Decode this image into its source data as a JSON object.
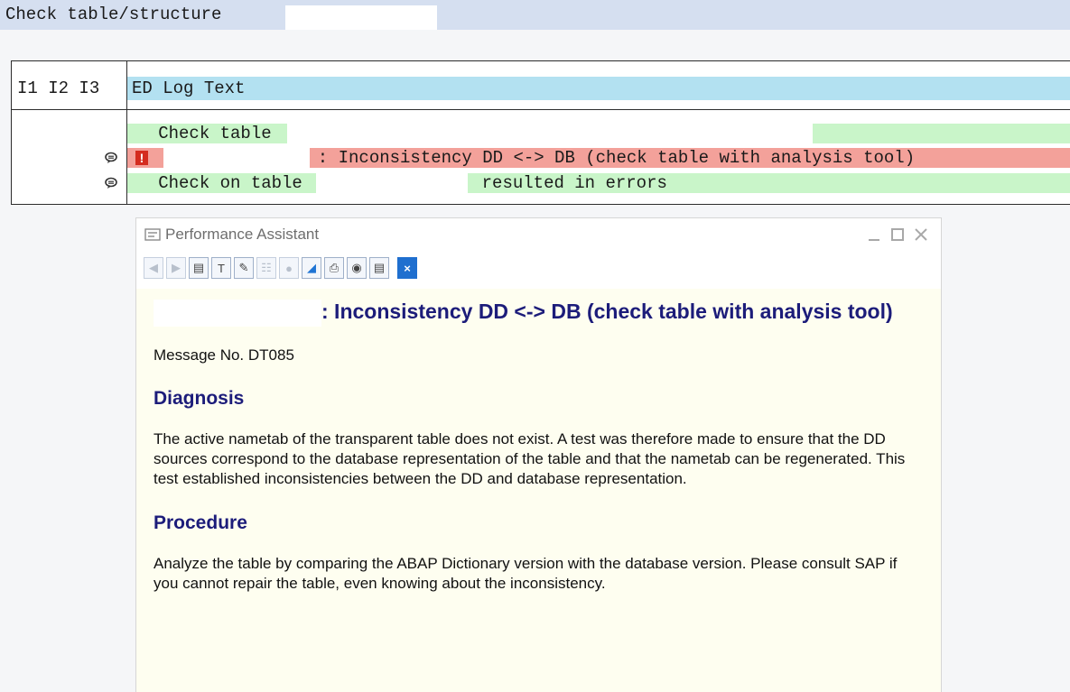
{
  "titlebar": {
    "title": "Check table/structure"
  },
  "log": {
    "header_left": "I1 I2 I3",
    "header_right": "ED Log Text",
    "rows": [
      {
        "text": "   Check table",
        "color": "green",
        "icon": ""
      },
      {
        "text": "  : Inconsistency DD <-> DB (check table with analysis tool)",
        "color": "red",
        "icon": "message-icon"
      },
      {
        "text": "   Check on table",
        "suffix": "resulted in errors",
        "color": "green",
        "icon": "message-icon"
      }
    ]
  },
  "dialog": {
    "title": "Performance Assistant",
    "message_title": ": Inconsistency DD <-> DB (check table with analysis tool)",
    "message_no": "Message No. DT085",
    "diagnosis_heading": "Diagnosis",
    "diagnosis_text": "The active nametab of the transparent table does not exist. A test was therefore made to ensure that the DD sources correspond to the database representation of the table and that the nametab can be regenerated. This test established inconsistencies between the DD and database representation.",
    "procedure_heading": "Procedure",
    "procedure_text": "Analyze the table by comparing the ABAP Dictionary version with the database version. Please consult SAP if you cannot repair the table, even knowing about the inconsistency."
  },
  "colors": {
    "titlebar_bg": "#d5dff0",
    "header_bg": "#b3e1f1",
    "row_green": "#c9f5c9",
    "row_red": "#f3a19a",
    "heading_text": "#1c1c7a"
  }
}
